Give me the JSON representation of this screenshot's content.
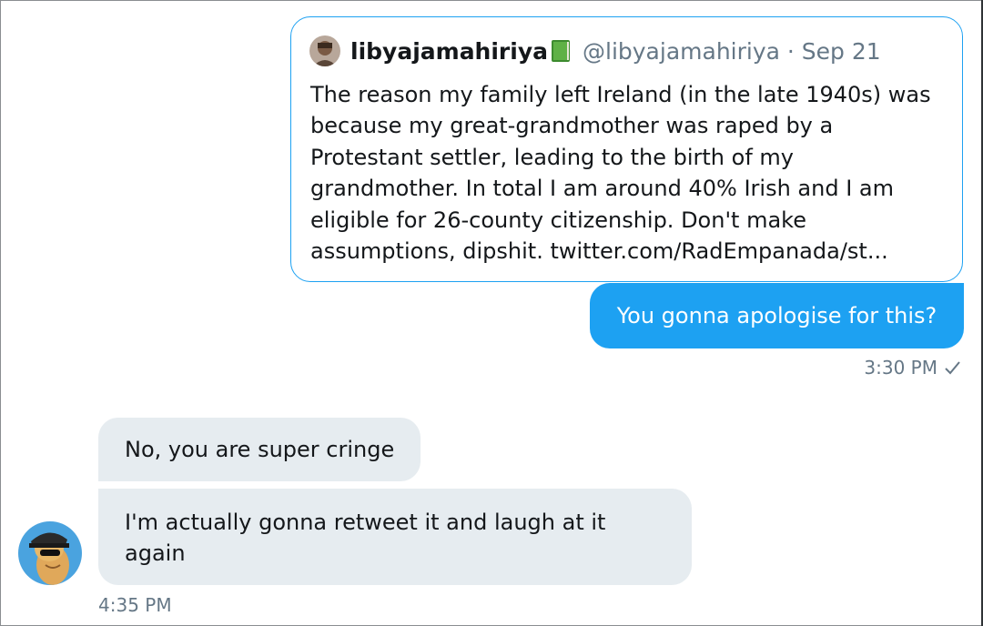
{
  "quoted_tweet": {
    "display_name": "libyajamahiriya",
    "badge_emoji": "green-book",
    "handle": "@libyajamahiriya",
    "separator": " · ",
    "date": "Sep 21",
    "text": "The reason my family left Ireland (in the late 1940s) was\nbecause my great-grandmother was raped by a\nProtestant settler, leading to the birth of my\ngrandmother. In total I am around 40% Irish and I am\neligible for 26-county citizenship. Don't make\nassumptions, dipshit. twitter.com/RadEmpanada/st..."
  },
  "sent_message": {
    "text": "You gonna apologise for this?",
    "time": "3:30 PM",
    "status_icon": "check-icon"
  },
  "received_messages": [
    {
      "text": "No, you are super cringe"
    },
    {
      "text": "I'm actually gonna retweet it and laugh at it\nagain"
    }
  ],
  "received_time": "4:35 PM",
  "colors": {
    "accent": "#1da1f2",
    "received_bubble": "#e6ecf0",
    "muted_text": "#657786"
  }
}
